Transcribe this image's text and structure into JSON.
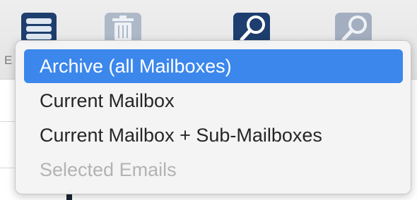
{
  "toolbar": {
    "buttons": [
      {
        "name": "archive-icon"
      },
      {
        "name": "trash-icon"
      },
      {
        "name": "search-icon"
      },
      {
        "name": "search-icon"
      }
    ],
    "partial_label": "E"
  },
  "menu": {
    "items": [
      {
        "label": "Archive (all Mailboxes)",
        "state": "selected"
      },
      {
        "label": "Current Mailbox",
        "state": "enabled"
      },
      {
        "label": "Current Mailbox + Sub-Mailboxes",
        "state": "enabled"
      },
      {
        "label": "Selected Emails",
        "state": "disabled"
      }
    ]
  },
  "colors": {
    "selection": "#3b87ec",
    "menu_background": "#f4f4f4",
    "disabled_text": "#b3b3b3",
    "icon_dark": "#1d3e6e"
  }
}
